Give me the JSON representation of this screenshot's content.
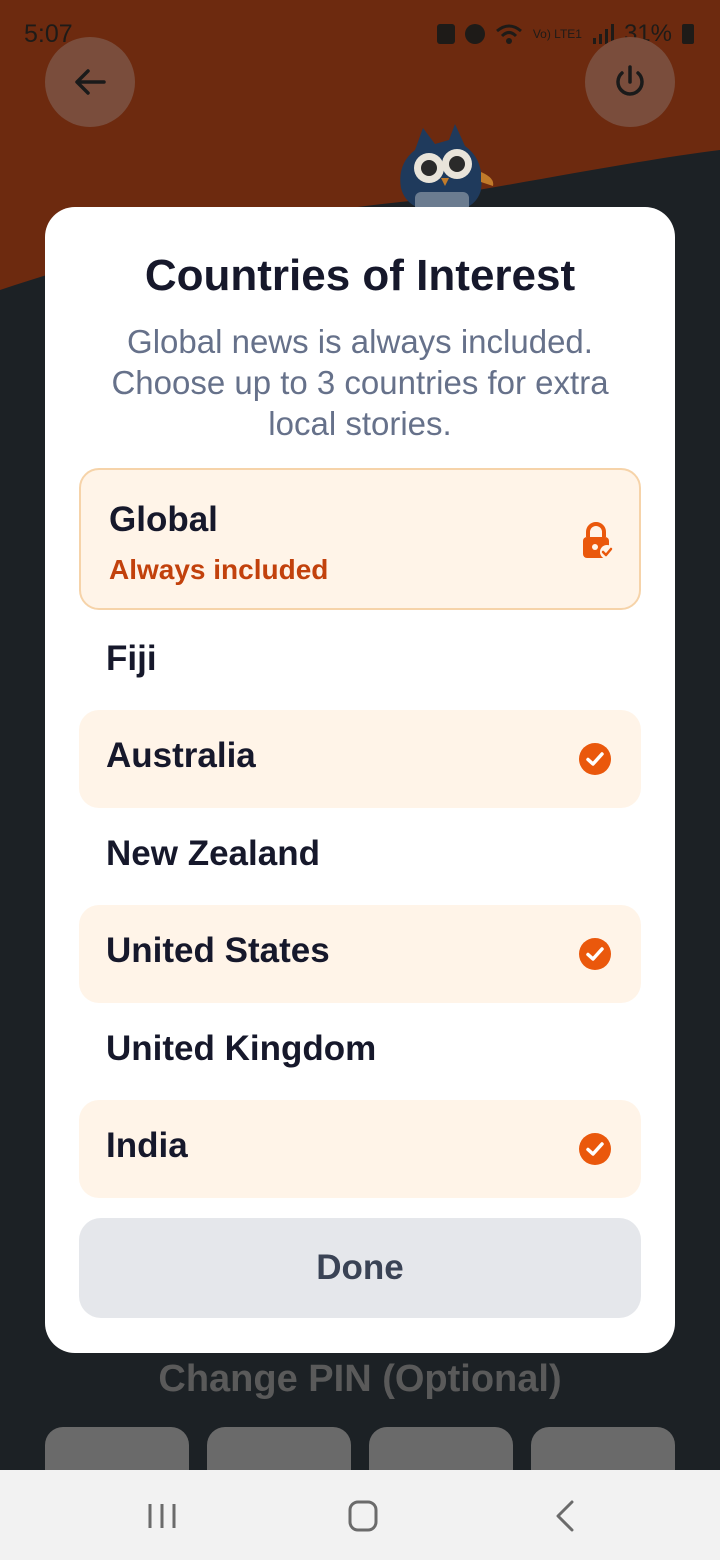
{
  "status_bar": {
    "time": "5:07",
    "network": "Vo) LTE1",
    "battery": "31%"
  },
  "dialog": {
    "title": "Countries of Interest",
    "subtitle": "Global news is always included. Choose up to 3 countries for extra local stories.",
    "global": {
      "name": "Global",
      "note": "Always included",
      "icon": "lock-check-icon"
    },
    "countries": [
      {
        "label": "Fiji",
        "selected": false
      },
      {
        "label": "Australia",
        "selected": true
      },
      {
        "label": "New Zealand",
        "selected": false
      },
      {
        "label": "United States",
        "selected": true
      },
      {
        "label": "United Kingdom",
        "selected": false
      },
      {
        "label": "India",
        "selected": true
      }
    ],
    "done_label": "Done"
  },
  "background": {
    "section_heading": "Change PIN (Optional)"
  },
  "colors": {
    "accent": "#ea580c",
    "selected_bg": "#fff4e8",
    "header_brown": "#6d2a0f",
    "title_text": "#16182b",
    "subtitle_text": "#66718a"
  }
}
